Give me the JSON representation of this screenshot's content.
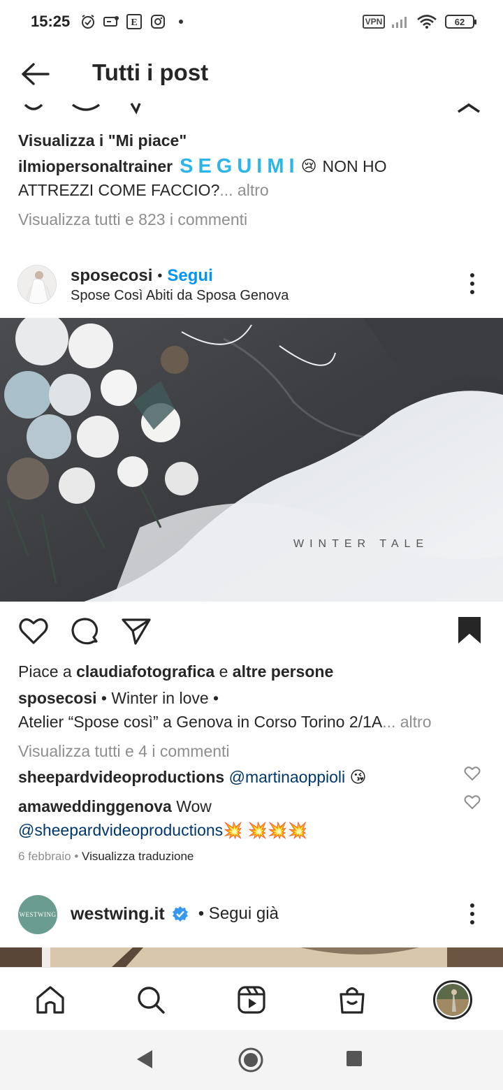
{
  "status_bar": {
    "time": "15:25",
    "vpn_label": "VPN",
    "battery": "62",
    "icons": [
      "alarm-icon",
      "notification-icon",
      "e-app-icon",
      "instagram-icon",
      "dot-icon",
      "vpn-icon",
      "signal-icon",
      "wifi-icon",
      "battery-icon"
    ]
  },
  "header": {
    "title": "Tutti i post",
    "back_icon": "arrow-left-icon"
  },
  "prev_post": {
    "likes_link": "Visualizza i \"Mi piace\"",
    "caption_user": "ilmiopersonaltrainer",
    "caption_highlight": "SEGUIMI",
    "caption_emoji": "😢",
    "caption_text_1": "NON HO",
    "caption_text_2": "ATTREZZI COME FACCIO?",
    "more": "... altro",
    "comments_link": "Visualizza tutti e 823 i commenti"
  },
  "post": {
    "username": "sposecosi",
    "separator": "•",
    "follow_label": "Segui",
    "subtitle": "Spose Così Abiti da Sposa Genova",
    "image_watermark": "WINTER TALE",
    "likes_prefix": "Piace a",
    "likes_user": "claudiafotografica",
    "likes_conj": "e",
    "likes_others": "altre persone",
    "caption_user": "sposecosi",
    "caption_line1": "• Winter in love •",
    "caption_line2": "Atelier “Spose così” a Genova in Corso Torino 2/1A",
    "caption_more": "... altro",
    "comments_link": "Visualizza tutti e 4 i commenti",
    "comments": [
      {
        "user": "sheepardvideoproductions",
        "mention": "@martinaoppioli",
        "text": "",
        "emoji": "😘"
      },
      {
        "user": "amaweddinggenova",
        "text": "Wow",
        "mention": "@sheepardvideoproductions",
        "emoji": "💥 💥💥💥"
      }
    ],
    "date": "6 febbraio",
    "dot": "•",
    "translate_link": "Visualizza traduzione"
  },
  "next_post": {
    "avatar_text": "WESTWING",
    "username": "westwing.it",
    "follow_label": "• Segui già"
  },
  "bottom_nav": {
    "items": [
      "home-icon",
      "search-icon",
      "reels-icon",
      "shop-icon",
      "profile-avatar"
    ]
  },
  "colors": {
    "accent_blue": "#0095f6",
    "highlight_text": "#2bb5e8",
    "mention": "#00376b",
    "secondary_text": "#8e8e8e"
  }
}
